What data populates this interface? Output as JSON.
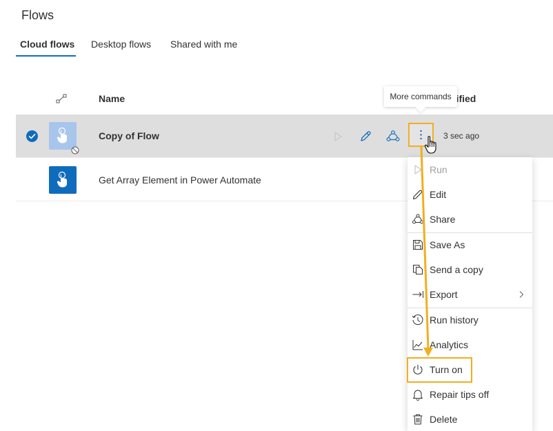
{
  "page": {
    "title": "Flows"
  },
  "tabs": [
    {
      "label": "Cloud flows",
      "active": true
    },
    {
      "label": "Desktop flows",
      "active": false
    },
    {
      "label": "Shared with me",
      "active": false
    }
  ],
  "table": {
    "columns": {
      "type_icon": "connector-icon",
      "name": "Name",
      "modified": "dified"
    },
    "rows": [
      {
        "name": "Copy of Flow",
        "modified": "3 sec ago",
        "selected": true,
        "state": "off"
      },
      {
        "name": "Get Array Element in Power Automate",
        "modified": "",
        "selected": false,
        "state": "on"
      }
    ]
  },
  "tooltip": {
    "text": "More commands"
  },
  "menu": {
    "items": [
      {
        "label": "Run",
        "icon": "play-icon",
        "disabled": true
      },
      {
        "label": "Edit",
        "icon": "pencil-icon"
      },
      {
        "label": "Share",
        "icon": "share-icon"
      },
      {
        "label": "Save As",
        "icon": "save-as-icon"
      },
      {
        "label": "Send a copy",
        "icon": "copy-icon"
      },
      {
        "label": "Export",
        "icon": "export-icon",
        "submenu": true
      },
      {
        "label": "Run history",
        "icon": "history-icon"
      },
      {
        "label": "Analytics",
        "icon": "analytics-icon"
      },
      {
        "label": "Turn on",
        "icon": "power-icon",
        "highlighted": true
      },
      {
        "label": "Repair tips off",
        "icon": "bell-icon"
      },
      {
        "label": "Delete",
        "icon": "trash-icon"
      }
    ]
  },
  "colors": {
    "accent": "#0f6cbd",
    "annotation": "#f2ae1e",
    "selected_row": "#dedede"
  }
}
